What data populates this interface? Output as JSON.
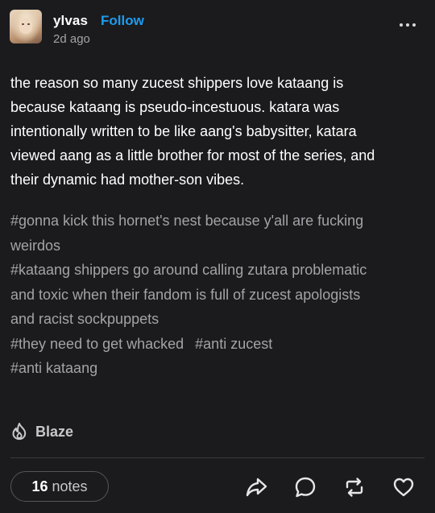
{
  "post": {
    "author": "ylvas",
    "follow_label": "Follow",
    "timestamp": "2d ago",
    "more_icon": "more-dots-icon",
    "body_lines": [
      "the reason so many zucest shippers love kataang is",
      "because kataang is pseudo-incestuous. katara was",
      "intentionally written to be like aang's babysitter, katara",
      "viewed aang as a little brother for most of the series, and",
      "their dynamic had mother-son vibes."
    ],
    "tags": [
      "#gonna kick this hornet's nest because y'all are fucking weirdos",
      "#kataang shippers go around calling zutara problematic and toxic when their fandom is full of zucest apologists and racist sockpuppets",
      "#they need to get whacked",
      "#anti zucest",
      "#anti kataang"
    ],
    "tag_lines": {
      "t0a": "#gonna kick this hornet's nest because y'all are fucking",
      "t0b": "weirdos",
      "t1a": "#kataang shippers go around calling zutara problematic",
      "t1b": "and toxic when their fandom is full of zucest apologists",
      "t1c": "and racist sockpuppets"
    }
  },
  "blaze": {
    "label": "Blaze",
    "icon": "flame-icon"
  },
  "footer": {
    "notes_count": "16",
    "notes_word": "notes",
    "actions": [
      "share-icon",
      "reply-icon",
      "reblog-icon",
      "like-icon"
    ]
  },
  "colors": {
    "background": "#1b1b1d",
    "accent": "#1e9bf0",
    "muted_text": "#a3a3a8"
  }
}
